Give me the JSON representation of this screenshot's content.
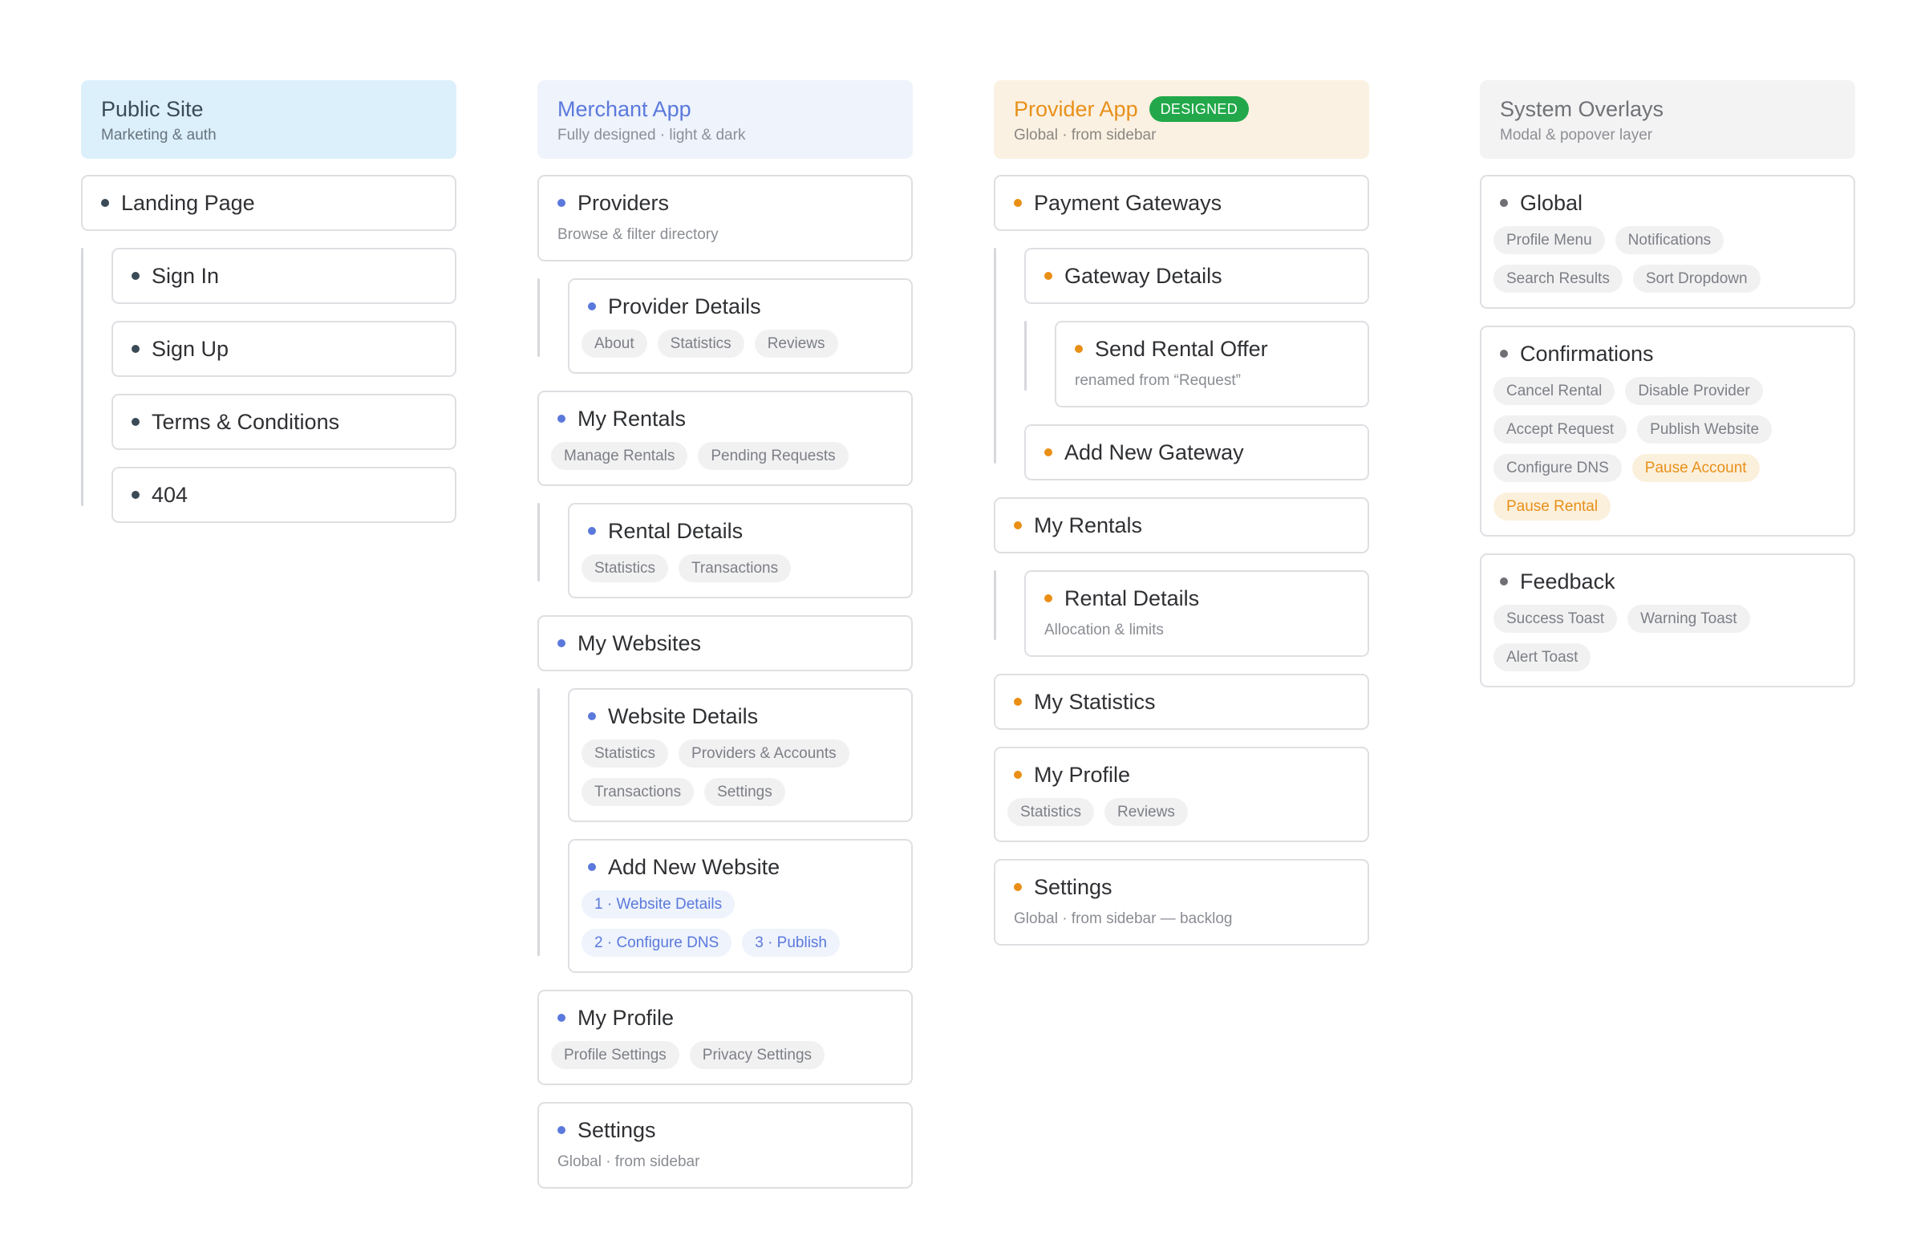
{
  "columns": {
    "public": {
      "title": "Public Site",
      "subtitle": "Marketing & auth",
      "landing": "Landing Page",
      "sign_in": "Sign In",
      "sign_up": "Sign Up",
      "terms": "Terms & Conditions",
      "not_found": "404"
    },
    "merchant": {
      "title": "Merchant App",
      "subtitle": "Fully designed · light & dark",
      "providers": {
        "title": "Providers",
        "sub": "Browse & filter directory"
      },
      "provider_details": {
        "title": "Provider Details",
        "chips": [
          "About",
          "Statistics",
          "Reviews"
        ]
      },
      "my_rentals": {
        "title": "My Rentals",
        "chips": [
          "Manage Rentals",
          "Pending Requests"
        ]
      },
      "rental_details": {
        "title": "Rental Details",
        "chips": [
          "Statistics",
          "Transactions"
        ]
      },
      "my_websites": {
        "title": "My Websites"
      },
      "website_details": {
        "title": "Website Details",
        "chips": [
          "Statistics",
          "Providers & Accounts",
          "Transactions",
          "Settings"
        ]
      },
      "add_website": {
        "title": "Add New Website",
        "chips": [
          "1 · Website Details",
          "2 · Configure DNS",
          "3 · Publish"
        ]
      },
      "my_profile": {
        "title": "My Profile",
        "chips": [
          "Profile Settings",
          "Privacy Settings"
        ]
      },
      "settings": {
        "title": "Settings",
        "sub": "Global · from sidebar"
      }
    },
    "provider": {
      "title": "Provider App",
      "badge": "DESIGNED",
      "subtitle": "Global · from sidebar",
      "payment_gateways": {
        "title": "Payment Gateways"
      },
      "gateway_details": {
        "title": "Gateway Details"
      },
      "send_offer": {
        "title": "Send Rental Offer",
        "sub": "renamed from “Request”"
      },
      "add_gateway": {
        "title": "Add New Gateway"
      },
      "my_rentals": {
        "title": "My Rentals"
      },
      "rental_details": {
        "title": "Rental Details",
        "sub": "Allocation & limits"
      },
      "my_statistics": {
        "title": "My Statistics"
      },
      "my_profile": {
        "title": "My Profile",
        "chips": [
          "Statistics",
          "Reviews"
        ]
      },
      "settings": {
        "title": "Settings",
        "sub": "Global · from sidebar — backlog"
      }
    },
    "system": {
      "title": "System Overlays",
      "subtitle": "Modal & popover layer",
      "global": {
        "title": "Global",
        "chips": [
          "Profile Menu",
          "Notifications",
          "Search Results",
          "Sort Dropdown"
        ]
      },
      "confirmations": {
        "title": "Confirmations",
        "chips": [
          "Cancel Rental",
          "Disable Provider",
          "Accept Request",
          "Publish Website",
          "Configure DNS",
          "Pause Account",
          "Pause Rental"
        ]
      },
      "feedback": {
        "title": "Feedback",
        "chips": [
          "Success Toast",
          "Warning Toast",
          "Alert Toast"
        ]
      }
    }
  },
  "colors": {
    "public_accent": "#3a4b57",
    "merchant_accent": "#5b79dc",
    "provider_accent": "#ea8f15",
    "system_accent": "#6e7074",
    "designed_badge": "#22a84a"
  }
}
